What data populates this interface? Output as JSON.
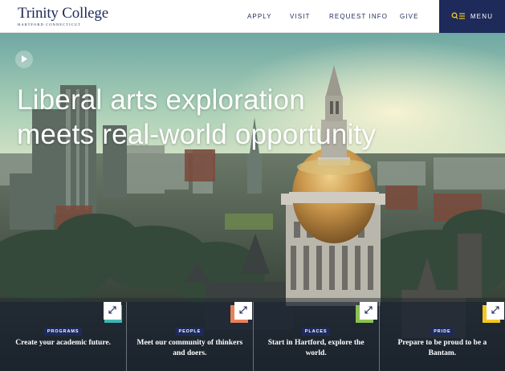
{
  "brand": {
    "name": "Trinity College",
    "subtitle": "HARTFORD CONNECTICUT",
    "color": "#1d2a5a"
  },
  "nav": {
    "items": [
      {
        "label": "APPLY"
      },
      {
        "label": "VISIT"
      },
      {
        "label": "REQUEST INFO"
      },
      {
        "label": "GIVE"
      }
    ],
    "menu_label": "MENU",
    "menu_icon": "search-menu-icon"
  },
  "hero": {
    "video_control": "play-icon",
    "headline_line1": "Liberal arts exploration",
    "headline_line2": "meets real-world opportunity"
  },
  "cards": [
    {
      "tag": "PROGRAMS",
      "caption": "Create your academic future.",
      "accent": "#3fb6b2",
      "icon": "expand-icon"
    },
    {
      "tag": "PEOPLE",
      "caption": "Meet our community of thinkers and doers.",
      "accent": "#e8805a",
      "icon": "expand-icon"
    },
    {
      "tag": "PLACES",
      "caption": "Start in Hartford, explore the world.",
      "accent": "#8cc152",
      "icon": "expand-icon"
    },
    {
      "tag": "PRIDE",
      "caption": "Prepare to be proud to be a Bantam.",
      "accent": "#f2c81f",
      "icon": "expand-icon"
    }
  ]
}
